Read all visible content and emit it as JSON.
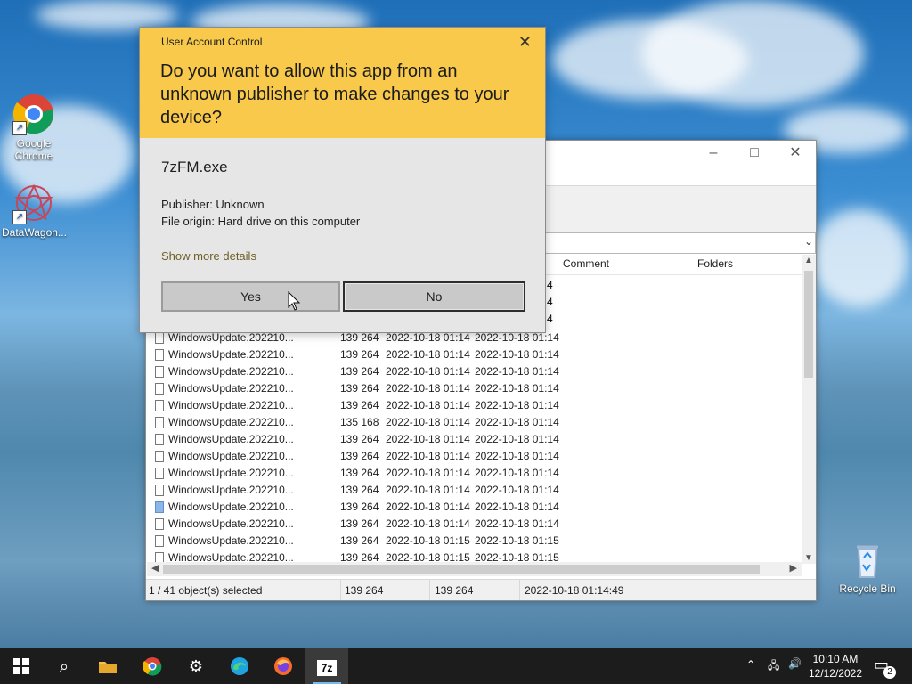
{
  "desktop": {
    "icons": [
      {
        "label": "Google Chrome"
      },
      {
        "label": "DataWagon..."
      },
      {
        "label": "Recycle Bin"
      }
    ]
  },
  "explorer": {
    "columns": {
      "comment": "Comment",
      "folders": "Folders"
    },
    "partial_rows": [
      "4",
      "4",
      "4"
    ],
    "rows": [
      {
        "name": "WindowsUpdate.202210...",
        "size": "139 264",
        "modified": "2022-10-18 01:14",
        "created": "2022-10-18 01:14"
      },
      {
        "name": "WindowsUpdate.202210...",
        "size": "139 264",
        "modified": "2022-10-18 01:14",
        "created": "2022-10-18 01:14"
      },
      {
        "name": "WindowsUpdate.202210...",
        "size": "139 264",
        "modified": "2022-10-18 01:14",
        "created": "2022-10-18 01:14"
      },
      {
        "name": "WindowsUpdate.202210...",
        "size": "139 264",
        "modified": "2022-10-18 01:14",
        "created": "2022-10-18 01:14"
      },
      {
        "name": "WindowsUpdate.202210...",
        "size": "139 264",
        "modified": "2022-10-18 01:14",
        "created": "2022-10-18 01:14"
      },
      {
        "name": "WindowsUpdate.202210...",
        "size": "135 168",
        "modified": "2022-10-18 01:14",
        "created": "2022-10-18 01:14"
      },
      {
        "name": "WindowsUpdate.202210...",
        "size": "139 264",
        "modified": "2022-10-18 01:14",
        "created": "2022-10-18 01:14"
      },
      {
        "name": "WindowsUpdate.202210...",
        "size": "139 264",
        "modified": "2022-10-18 01:14",
        "created": "2022-10-18 01:14"
      },
      {
        "name": "WindowsUpdate.202210...",
        "size": "139 264",
        "modified": "2022-10-18 01:14",
        "created": "2022-10-18 01:14"
      },
      {
        "name": "WindowsUpdate.202210...",
        "size": "139 264",
        "modified": "2022-10-18 01:14",
        "created": "2022-10-18 01:14"
      },
      {
        "name": "WindowsUpdate.202210...",
        "size": "139 264",
        "modified": "2022-10-18 01:14",
        "created": "2022-10-18 01:14"
      },
      {
        "name": "WindowsUpdate.202210...",
        "size": "139 264",
        "modified": "2022-10-18 01:14",
        "created": "2022-10-18 01:14"
      },
      {
        "name": "WindowsUpdate.202210...",
        "size": "139 264",
        "modified": "2022-10-18 01:15",
        "created": "2022-10-18 01:15"
      },
      {
        "name": "WindowsUpdate.202210...",
        "size": "139 264",
        "modified": "2022-10-18 01:15",
        "created": "2022-10-18 01:15"
      }
    ],
    "status": {
      "selected": "1 / 41 object(s) selected",
      "size_1": "139 264",
      "size_2": "139 264",
      "datetime": "2022-10-18 01:14:49"
    }
  },
  "uac": {
    "caption": "User Account Control",
    "question": "Do you want to allow this app from an unknown publisher to make changes to your device?",
    "app_name": "7zFM.exe",
    "publisher": "Publisher: Unknown",
    "origin": "File origin: Hard drive on this computer",
    "details_link": "Show more details",
    "yes_label": "Yes",
    "no_label": "No"
  },
  "taskbar": {
    "time": "10:10 AM",
    "date": "12/12/2022",
    "notifications": "2",
    "active_app": "7z"
  }
}
